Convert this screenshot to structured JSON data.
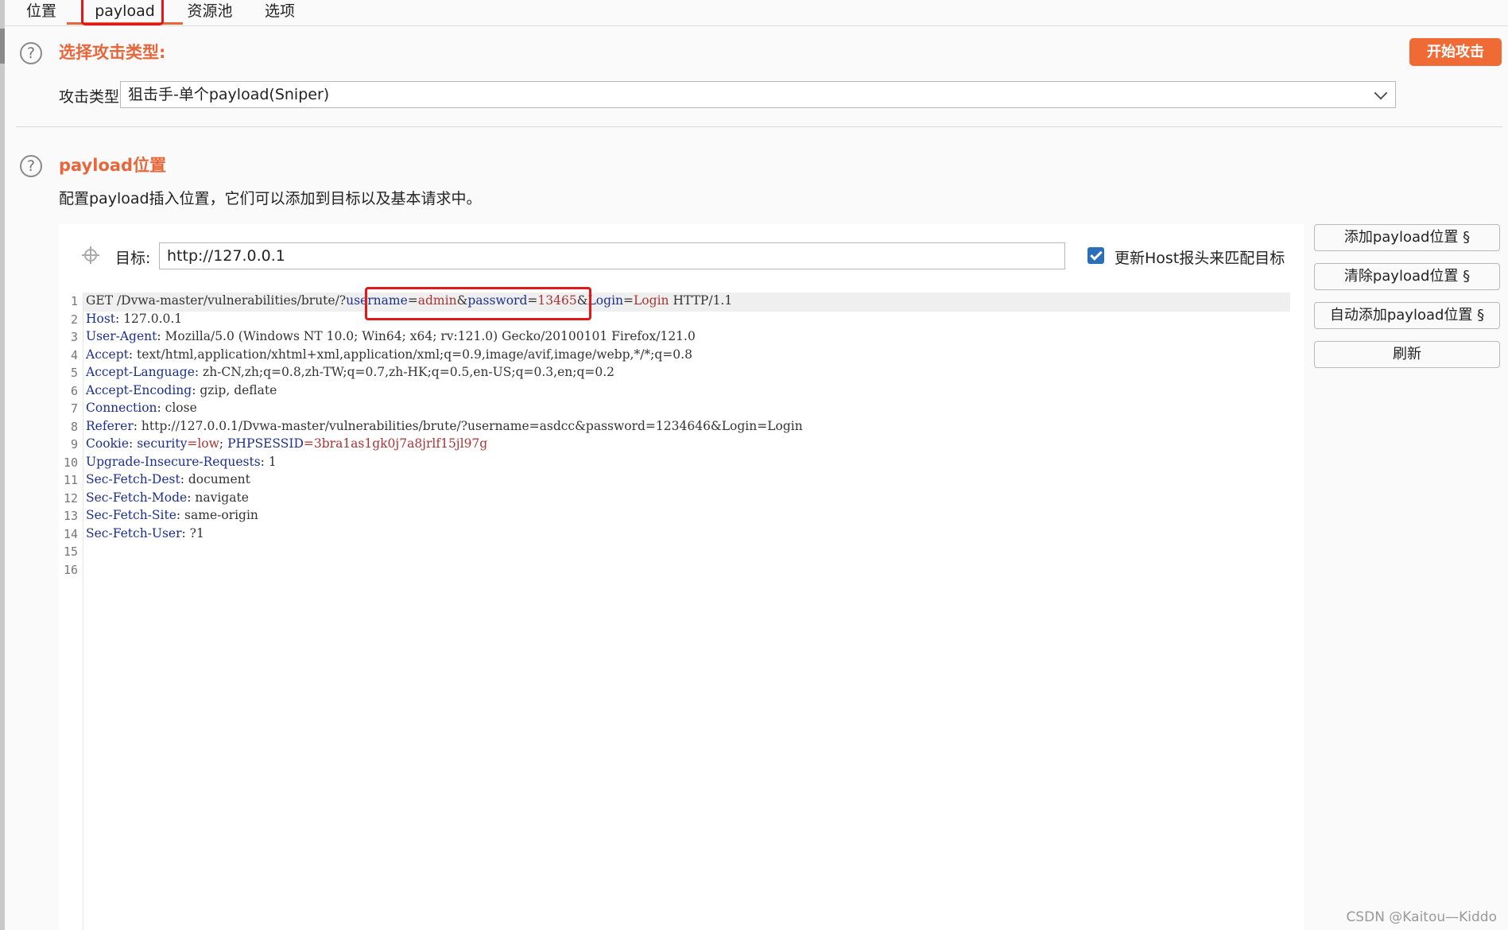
{
  "tabs": [
    {
      "label": "位置"
    },
    {
      "label": "payload"
    },
    {
      "label": "资源池"
    },
    {
      "label": "选项"
    }
  ],
  "attack_section": {
    "help": "?",
    "title": "选择攻击类型:",
    "start_button": "开始攻击",
    "type_label": "攻击类型:",
    "type_value": "狙击手-单个payload(Sniper)"
  },
  "positions_section": {
    "help": "?",
    "title": "payload位置",
    "description": "配置payload插入位置，它们可以添加到目标以及基本请求中。",
    "target_label": "目标:",
    "target_value": "http://127.0.0.1",
    "update_host_label": "更新Host报头来匹配目标",
    "update_host_checked": true
  },
  "side_buttons": {
    "add": "添加payload位置 §",
    "clear": "清除payload位置 §",
    "auto": "自动添加payload位置 §",
    "refresh": "刷新"
  },
  "request": {
    "line_numbers": [
      "1",
      "2",
      "3",
      "4",
      "5",
      "6",
      "7",
      "8",
      "9",
      "10",
      "11",
      "12",
      "13",
      "14",
      "15",
      "16"
    ],
    "line1": {
      "method_path": "GET /Dvwa-master/vulnerabilities/brute/?",
      "p1k": "username",
      "eq1": "=",
      "p1v": "admin",
      "amp1": "&",
      "p2k": "password",
      "eq2": "=",
      "p2v": "13465",
      "amp2": "&",
      "p3k": "Login",
      "eq3": "=",
      "p3v": "Login",
      "proto": " HTTP/1.1"
    },
    "headers": [
      {
        "k": "Host",
        "v": ": 127.0.0.1"
      },
      {
        "k": "User-Agent",
        "v": ": Mozilla/5.0 (Windows NT 10.0; Win64; x64; rv:121.0) Gecko/20100101 Firefox/121.0"
      },
      {
        "k": "Accept",
        "v": ": text/html,application/xhtml+xml,application/xml;q=0.9,image/avif,image/webp,*/*;q=0.8"
      },
      {
        "k": "Accept-Language",
        "v": ": zh-CN,zh;q=0.8,zh-TW;q=0.7,zh-HK;q=0.5,en-US;q=0.3,en;q=0.2"
      },
      {
        "k": "Accept-Encoding",
        "v": ": gzip, deflate"
      },
      {
        "k": "Connection",
        "v": ": close"
      },
      {
        "k": "Referer",
        "v": ": http://127.0.0.1/Dvwa-master/vulnerabilities/brute/?username=asdcc&password=1234646&Login=Login"
      },
      {
        "k": "Cookie",
        "v": ": "
      },
      {
        "k": "Upgrade-Insecure-Requests",
        "v": ": 1"
      },
      {
        "k": "Sec-Fetch-Dest",
        "v": ": document"
      },
      {
        "k": "Sec-Fetch-Mode",
        "v": ": navigate"
      },
      {
        "k": "Sec-Fetch-Site",
        "v": ": same-origin"
      },
      {
        "k": "Sec-Fetch-User",
        "v": ": ?1"
      }
    ],
    "cookie": {
      "k1": "security",
      "v1": "=low",
      "sep": "; ",
      "k2": "PHPSESSID",
      "v2": "=3bra1as1gk0j7a8jrlf15jl97g"
    }
  },
  "watermark": "CSDN @Kaitou—Kiddo",
  "colors": {
    "accent": "#e8673a",
    "start_button": "#f06a36",
    "highlight_box": "#e01818",
    "checkbox": "#2a6fb8"
  }
}
